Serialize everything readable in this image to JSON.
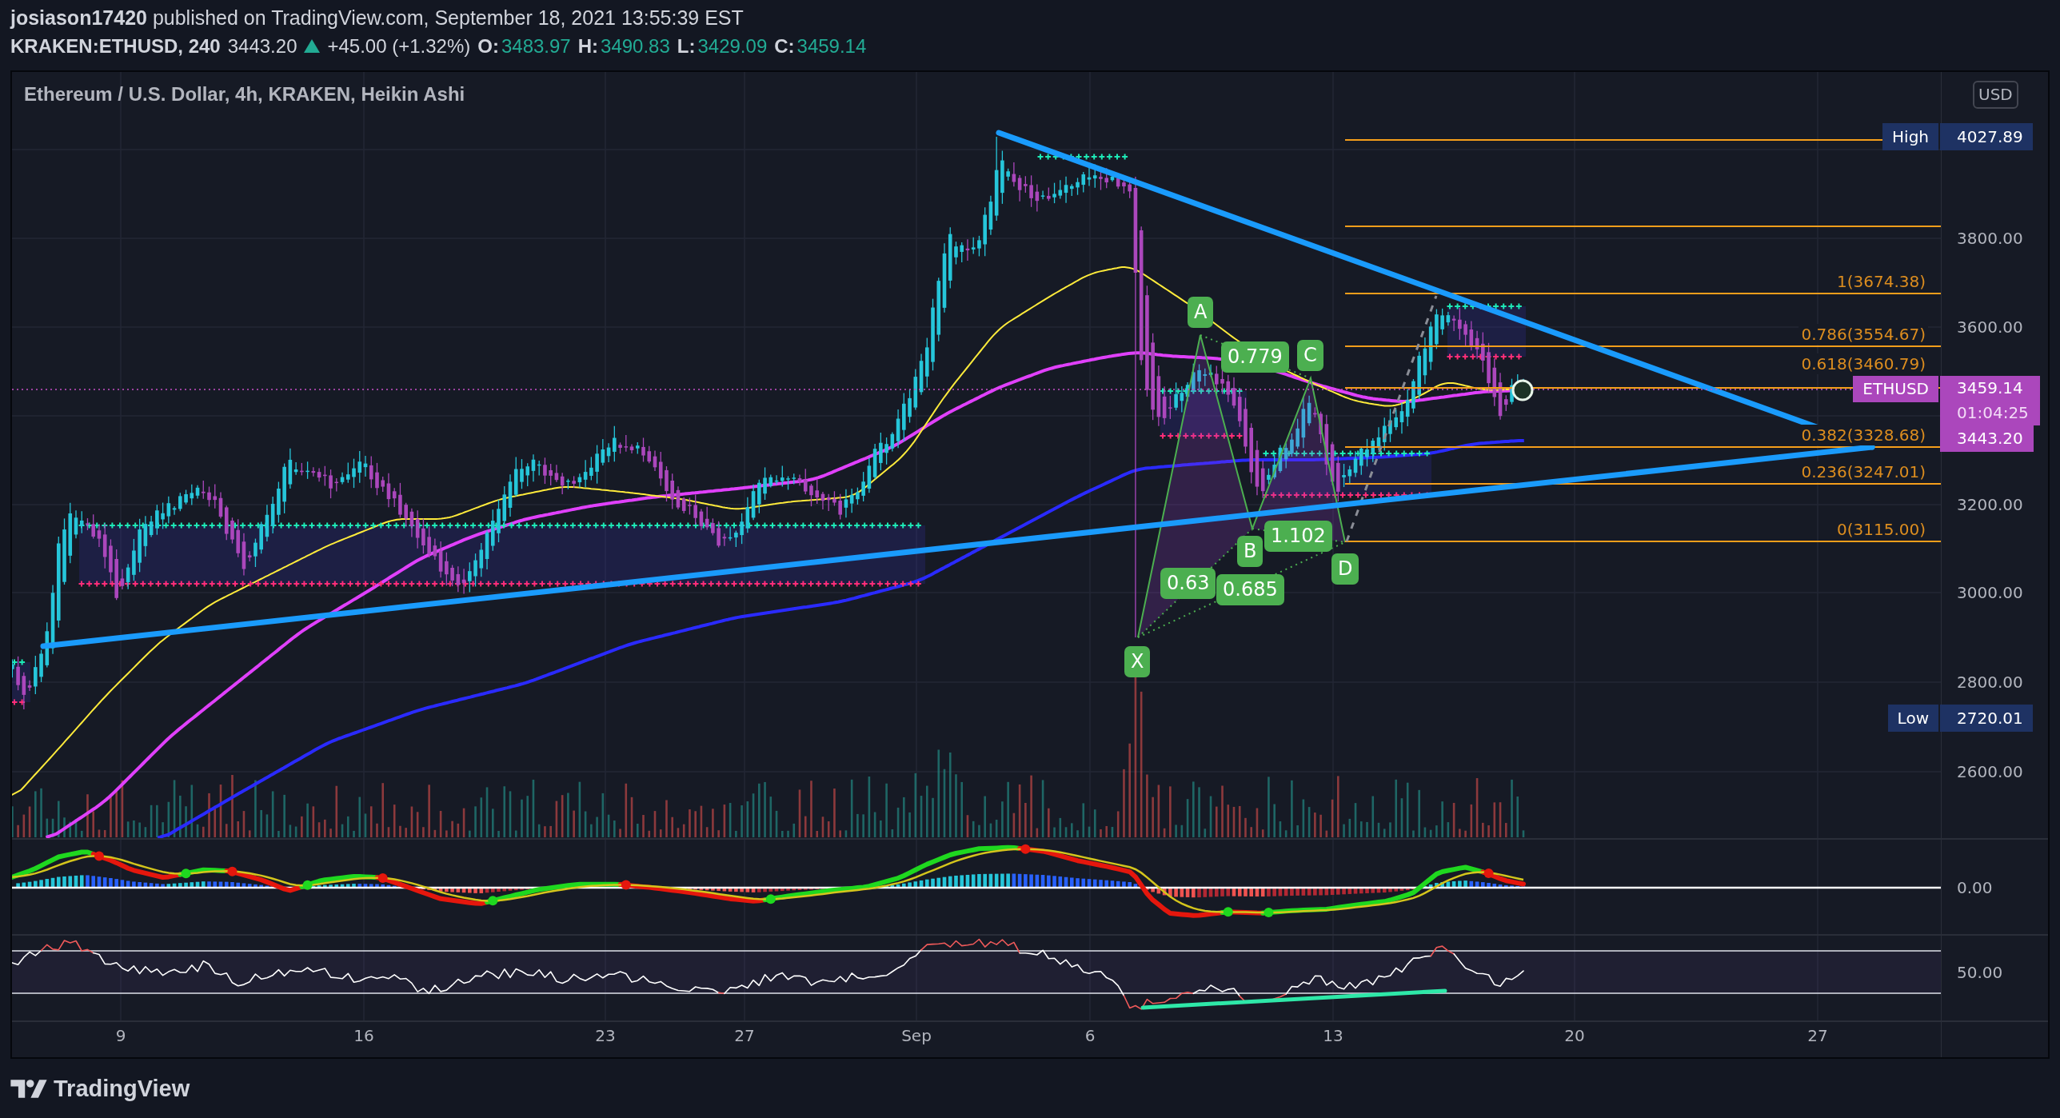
{
  "header": {
    "byline": "**josiason17420** published on TradingView.com, September 18, 2021 13:55:39 EST"
  },
  "quote": {
    "symbol": "KRAKEN:ETHUSD, 240",
    "last": "3443.20",
    "rising": true,
    "change": "+45.00 (+1.32%)",
    "ohlc": [
      {
        "label": "O:",
        "value": "3483.97"
      },
      {
        "label": "H:",
        "value": "3490.83"
      },
      {
        "label": "L:",
        "value": "3429.09"
      },
      {
        "label": "C:",
        "value": "3459.14"
      }
    ]
  },
  "chart": {
    "title": "Ethereum / U.S. Dollar, 4h, KRAKEN, Heikin Ashi",
    "currency": "USD",
    "price_ticks": [
      "3800.00",
      "3600.00",
      "3200.00",
      "3000.00",
      "2800.00",
      "2600.00"
    ],
    "high": {
      "label": "High",
      "value": "4027.89"
    },
    "low": {
      "label": "Low",
      "value": "2720.01"
    },
    "symbol_label": "ETHUSD",
    "price_badges": [
      "3459.14",
      "01:04:25",
      "3443.20"
    ],
    "fib_levels": [
      "1(3674.38)",
      "0.786(3554.67)",
      "0.618(3460.79)",
      "0.382(3328.68)",
      "0.236(3247.01)",
      "0(3115.00)"
    ],
    "pattern_labels": [
      "A",
      "0.779",
      "C",
      "1.102",
      "B",
      "D",
      "0.63",
      "0.685",
      "X"
    ]
  },
  "oscillator": {
    "axis_label": "0.00"
  },
  "rsi": {
    "axis_label": "50.00"
  },
  "time_axis": [
    "9",
    "16",
    "23",
    "27",
    "Sep",
    "6",
    "13",
    "20",
    "27"
  ],
  "footer": {
    "brand": "TradingView"
  }
}
